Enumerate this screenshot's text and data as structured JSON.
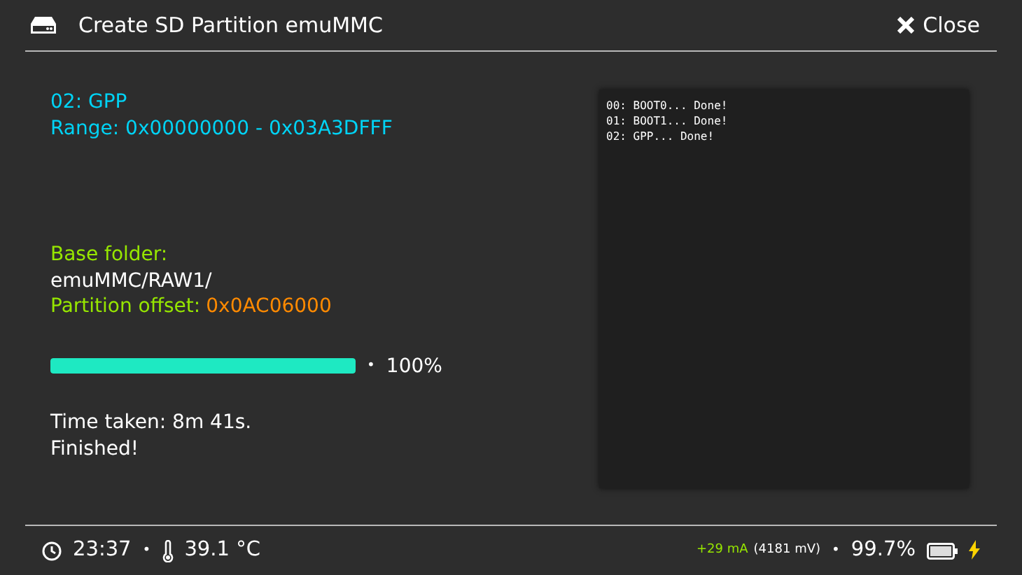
{
  "window": {
    "title": "Create SD Partition emuMMC",
    "close_label": "Close"
  },
  "partition": {
    "name": "02: GPP",
    "range": "Range: 0x00000000 - 0x03A3DFFF"
  },
  "base_folder": {
    "label": "Base folder:",
    "value": "emuMMC/RAW1/"
  },
  "offset": {
    "label": "Partition offset:",
    "value": "0x0AC06000"
  },
  "progress": {
    "level": 1.0,
    "separator": "•",
    "reading": "100%"
  },
  "messages": [
    "Time taken: 8m 41s.",
    "Finished!"
  ],
  "log": [
    "00: BOOT0... Done!",
    "01: BOOT1... Done!",
    "02: GPP... Done!"
  ],
  "status_bar": {
    "time": "23:37",
    "separator_1": "•",
    "temperature": "39.1 °C",
    "current": "+29 mA",
    "voltage": "(4181 mV)",
    "separator_2": "•",
    "battery": "99.7%",
    "charging": true
  }
}
